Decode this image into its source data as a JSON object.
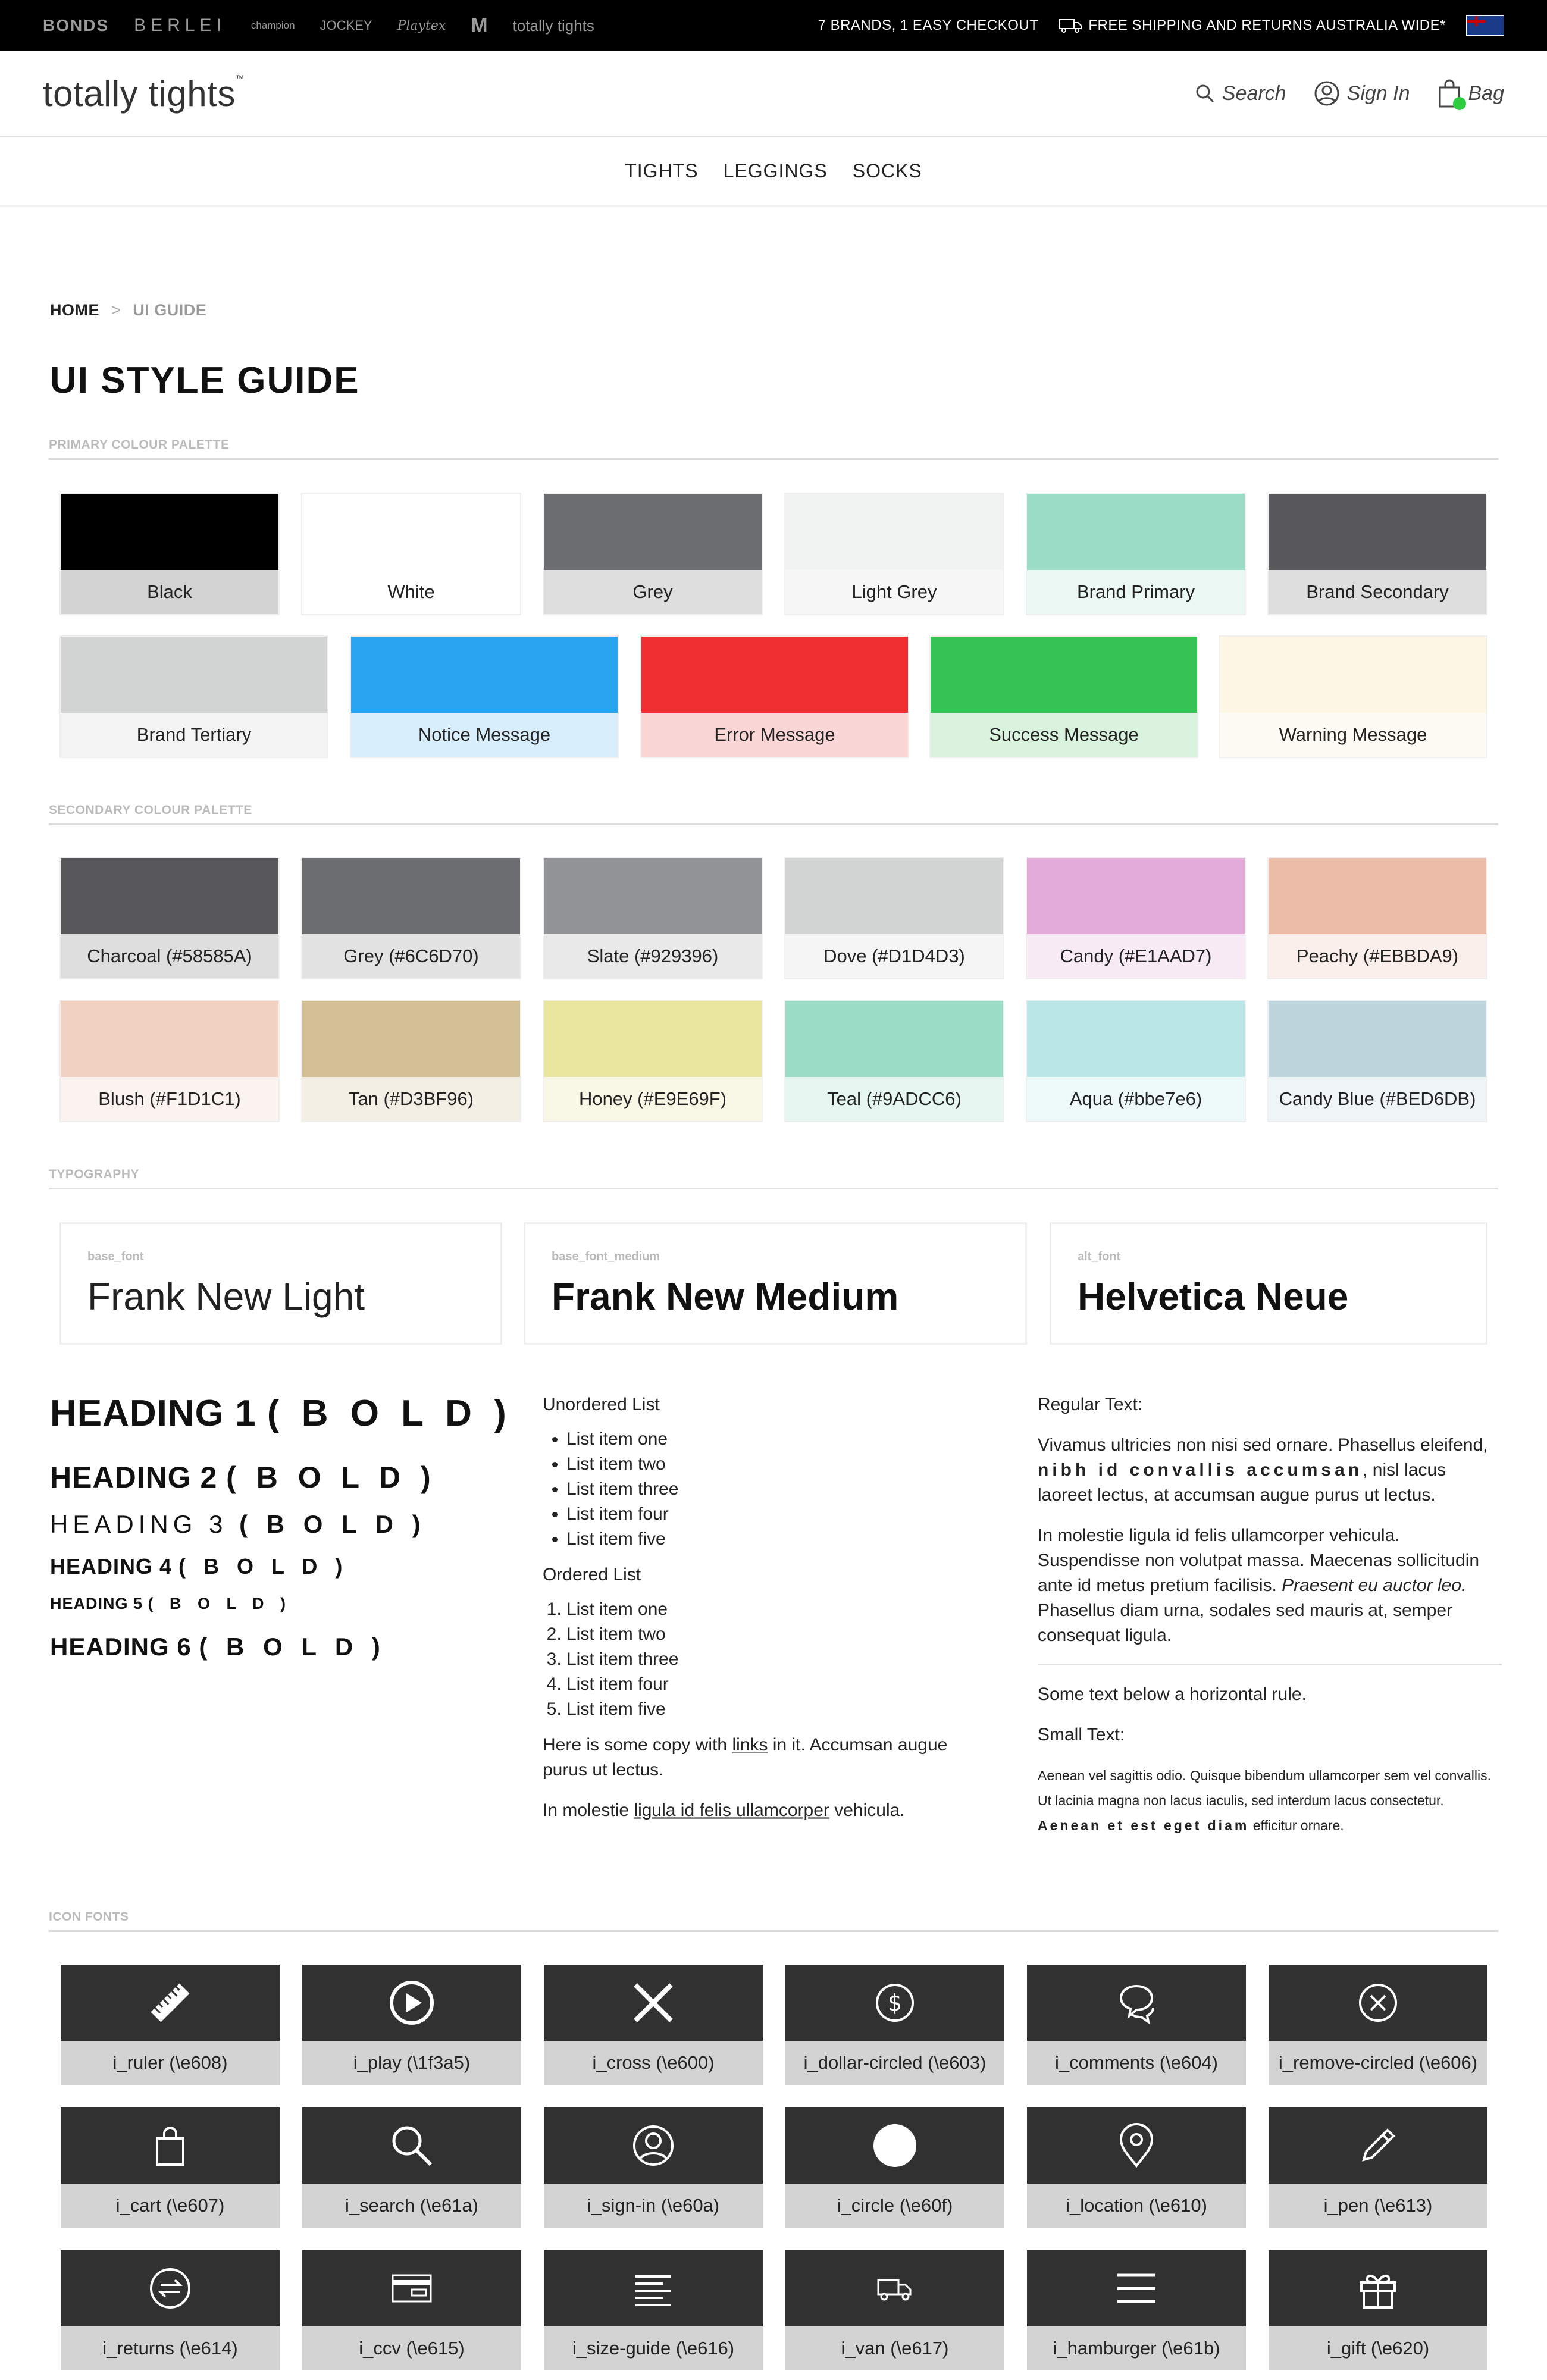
{
  "topbar": {
    "brands": [
      "BONDS",
      "BERLEI",
      "champion",
      "JOCKEY",
      "Playtex",
      "M",
      "totally tights"
    ],
    "promo1": "7 BRANDS, 1 EASY CHECKOUT",
    "promo2": "FREE SHIPPING AND RETURNS AUSTRALIA WIDE*"
  },
  "header": {
    "logo": "totally tights",
    "logo_tm": "™",
    "search": "Search",
    "signin": "Sign In",
    "bag": "Bag"
  },
  "nav": [
    "TIGHTS",
    "LEGGINGS",
    "SOCKS"
  ],
  "breadcrumb": {
    "home": "HOME",
    "sep": ">",
    "current": "UI GUIDE"
  },
  "title": "UI STYLE GUIDE",
  "sections": {
    "primary": "PRIMARY COLOUR PALETTE",
    "secondary": "SECONDARY COLOUR PALETTE",
    "typography": "TYPOGRAPHY",
    "icons": "ICON FONTS"
  },
  "primary_row1": [
    {
      "label": "Black",
      "color": "#000000",
      "bg": "#d3d3d3"
    },
    {
      "label": "White",
      "color": "#ffffff",
      "bg": "#ffffff"
    },
    {
      "label": "Grey",
      "color": "#6c6d70",
      "bg": "#dedede"
    },
    {
      "label": "Light Grey",
      "color": "#f1f2f2",
      "bg": "#f7f7f7"
    },
    {
      "label": "Brand Primary",
      "color": "#9adcc6",
      "bg": "#ebf8f3"
    },
    {
      "label": "Brand Secondary",
      "color": "#58585a",
      "bg": "#dedede"
    }
  ],
  "primary_row2": [
    {
      "label": "Brand Tertiary",
      "color": "#d1d4d3",
      "bg": "#f3f3f3"
    },
    {
      "label": "Notice Message",
      "color": "#29a4f0",
      "bg": "#d9eefc"
    },
    {
      "label": "Error Message",
      "color": "#ef2f32",
      "bg": "#fbd6d7"
    },
    {
      "label": "Success Message",
      "color": "#37c455",
      "bg": "#d9f3df"
    },
    {
      "label": "Warning Message",
      "color": "#fdf7e3",
      "bg": "#fdfbf3"
    }
  ],
  "secondary_row1": [
    {
      "label": "Charcoal (#58585A)",
      "color": "#58585a",
      "bg": "#dedede"
    },
    {
      "label": "Grey (#6C6D70)",
      "color": "#6c6d70",
      "bg": "#e2e2e3"
    },
    {
      "label": "Slate (#929396)",
      "color": "#929396",
      "bg": "#e9e9ea"
    },
    {
      "label": "Dove (#D1D4D3)",
      "color": "#d1d4d3",
      "bg": "#f4f5f4"
    },
    {
      "label": "Candy (#E1AAD7)",
      "color": "#e1aad7",
      "bg": "#f8ebf6"
    },
    {
      "label": "Peachy (#EBBDA9)",
      "color": "#ebbda9",
      "bg": "#faefea"
    }
  ],
  "secondary_row2": [
    {
      "label": "Blush (#F1D1C1)",
      "color": "#f1d1c1",
      "bg": "#fbf3ef"
    },
    {
      "label": "Tan (#D3BF96)",
      "color": "#d3bf96",
      "bg": "#f4efe4"
    },
    {
      "label": "Honey (#E9E69F)",
      "color": "#e9e69f",
      "bg": "#f9f8e7"
    },
    {
      "label": "Teal (#9ADCC6)",
      "color": "#9adcc6",
      "bg": "#e6f6f1"
    },
    {
      "label": "Aqua (#bbe7e6)",
      "color": "#bbe7e6",
      "bg": "#eef9f9"
    },
    {
      "label": "Candy Blue (#BED6DB)",
      "color": "#bed6db",
      "bg": "#eff5f6"
    }
  ],
  "fonts": [
    {
      "tag": "base_font",
      "name": "Frank New Light"
    },
    {
      "tag": "base_font_medium",
      "name": "Frank New Medium"
    },
    {
      "tag": "alt_font",
      "name": "Helvetica Neue"
    }
  ],
  "headings": {
    "h1": "HEADING 1",
    "h2": "HEADING 2",
    "h3": "HEADING 3",
    "h4": "HEADING 4",
    "h5": "HEADING 5",
    "h6": "HEADING 6",
    "bold": "( B O L D )"
  },
  "lists": {
    "unordered_title": "Unordered List",
    "unordered": [
      "List item one",
      "List item two",
      "List item three",
      "List item four",
      "List item five"
    ],
    "ordered_title": "Ordered List",
    "ordered": [
      "List item one",
      "List item two",
      "List item three",
      "List item four",
      "List item five"
    ],
    "copy1_a": "Here is some copy with ",
    "copy1_link": "links",
    "copy1_b": " in it. Accumsan augue purus ut lectus.",
    "copy2_a": "In molestie ",
    "copy2_link": "ligula id felis ullamcorper",
    "copy2_b": " vehicula."
  },
  "text": {
    "regular_title": "Regular Text:",
    "p1_a": "Vivamus ultricies non nisi sed ornare. Phasellus eleifend, ",
    "p1_b": "nibh id convallis accumsan",
    "p1_c": ", nisl lacus laoreet lectus, at accumsan augue purus ut lectus.",
    "p2_a": "In molestie ligula id felis ullamcorper vehicula. Suspendisse non volutpat massa. Maecenas sollicitudin ante id metus pretium facilisis. ",
    "p2_b": "Praesent eu auctor leo.",
    "p2_c": " Phasellus diam urna, sodales sed mauris at, semper consequat ligula.",
    "below_hr": "Some text below a horizontal rule.",
    "small_title": "Small Text:",
    "small_a": "Aenean vel sagittis odio. Quisque bibendum ullamcorper sem vel convallis. Ut lacinia magna non lacus iaculis, sed interdum lacus consectetur. ",
    "small_b": "Aenean et est eget diam",
    "small_c": " efficitur ornare."
  },
  "icons_row1": [
    {
      "label": "i_ruler (\\e608)",
      "icon": "ruler"
    },
    {
      "label": "i_play (\\1f3a5)",
      "icon": "play"
    },
    {
      "label": "i_cross (\\e600)",
      "icon": "cross"
    },
    {
      "label": "i_dollar-circled (\\e603)",
      "icon": "dollar"
    },
    {
      "label": "i_comments (\\e604)",
      "icon": "comments"
    },
    {
      "label": "i_remove-circled (\\e606)",
      "icon": "remove"
    }
  ],
  "icons_row2": [
    {
      "label": "i_cart (\\e607)",
      "icon": "cart"
    },
    {
      "label": "i_search (\\e61a)",
      "icon": "search"
    },
    {
      "label": "i_sign-in (\\e60a)",
      "icon": "signin"
    },
    {
      "label": "i_circle (\\e60f)",
      "icon": "circle"
    },
    {
      "label": "i_location (\\e610)",
      "icon": "location"
    },
    {
      "label": "i_pen (\\e613)",
      "icon": "pen"
    }
  ],
  "icons_row3": [
    {
      "label": "i_returns (\\e614)",
      "icon": "returns"
    },
    {
      "label": "i_ccv (\\e615)",
      "icon": "ccv"
    },
    {
      "label": "i_size-guide (\\e616)",
      "icon": "sizeguide"
    },
    {
      "label": "i_van (\\e617)",
      "icon": "van"
    },
    {
      "label": "i_hamburger (\\e61b)",
      "icon": "hamburger"
    },
    {
      "label": "i_gift (\\e620)",
      "icon": "gift"
    }
  ]
}
